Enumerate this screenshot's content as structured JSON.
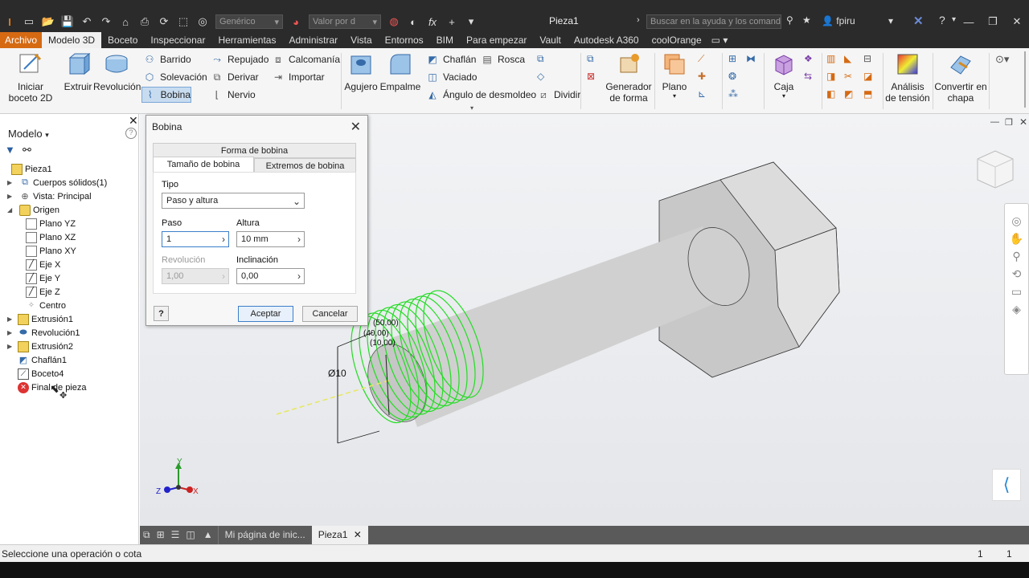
{
  "titlebar": {
    "material_placeholder": "Genérico",
    "appearance_placeholder": "Valor por d",
    "doc_title": "Pieza1",
    "search_placeholder": "Buscar en la ayuda y los comandos",
    "user": "fpiru"
  },
  "menu": {
    "tabs": [
      "Archivo",
      "Modelo 3D",
      "Boceto",
      "Inspeccionar",
      "Herramientas",
      "Administrar",
      "Vista",
      "Entornos",
      "BIM",
      "Para empezar",
      "Vault",
      "Autodesk A360",
      "coolOrange"
    ]
  },
  "ribbon": {
    "iniciar_boceto": "Iniciar\nboceto 2D",
    "extruir": "Extruir",
    "revolucion": "Revolución",
    "barrido": "Barrido",
    "solevacion": "Solevación",
    "bobina": "Bobina",
    "repujado": "Repujado",
    "derivar": "Derivar",
    "nervio": "Nervio",
    "calcomania": "Calcomanía",
    "importar": "Importar",
    "agujero": "Agujero",
    "empalme": "Empalme",
    "chaflan": "Chaflán",
    "rosca": "Rosca",
    "vaciado": "Vaciado",
    "angulo": "Ángulo de desmoldeo",
    "dividir": "Dividir",
    "generador1": "Generador",
    "generador2": "de forma",
    "plano": "Plano",
    "caja": "Caja",
    "analisis1": "Análisis",
    "analisis2": "de tensión",
    "convertir1": "Convertir en",
    "convertir2": "chapa"
  },
  "browser": {
    "header": "Modelo",
    "items": [
      {
        "label": "Pieza1",
        "icon": "part-icon"
      },
      {
        "label": "Cuerpos sólidos(1)",
        "icon": "solid-bodies-icon"
      },
      {
        "label": "Vista: Principal",
        "icon": "view-icon"
      },
      {
        "label": "Origen",
        "icon": "folder-icon"
      },
      {
        "label": "Plano YZ",
        "icon": "plane-icon"
      },
      {
        "label": "Plano XZ",
        "icon": "plane-icon"
      },
      {
        "label": "Plano XY",
        "icon": "plane-icon"
      },
      {
        "label": "Eje X",
        "icon": "axis-icon"
      },
      {
        "label": "Eje Y",
        "icon": "axis-icon"
      },
      {
        "label": "Eje Z",
        "icon": "axis-icon"
      },
      {
        "label": "Centro",
        "icon": "point-icon"
      },
      {
        "label": "Extrusión1",
        "icon": "extrude-icon"
      },
      {
        "label": "Revolución1",
        "icon": "revolve-icon"
      },
      {
        "label": "Extrusión2",
        "icon": "extrude-icon"
      },
      {
        "label": "Chaflán1",
        "icon": "chamfer-icon"
      },
      {
        "label": "Boceto4",
        "icon": "sketch-icon"
      },
      {
        "label": "Final de pieza",
        "icon": "end-of-part-icon"
      }
    ]
  },
  "dialog": {
    "title": "Bobina",
    "tab_forma": "Forma de bobina",
    "tab_tamano": "Tamaño de bobina",
    "tab_extremos": "Extremos de bobina",
    "tipo_label": "Tipo",
    "tipo_value": "Paso y altura",
    "paso_label": "Paso",
    "paso_value": "1",
    "altura_label": "Altura",
    "altura_value": "10 mm",
    "revolucion_label": "Revolución",
    "revolucion_value": "1,00",
    "inclinacion_label": "Inclinación",
    "inclinacion_value": "0,00",
    "help": "?",
    "ok": "Aceptar",
    "cancel": "Cancelar"
  },
  "viewport": {
    "dim_diameter": "Ø10",
    "dim_a": "(50,00)",
    "dim_b": "(40,00)",
    "dim_c": "(10,00)",
    "axis_x": "X",
    "axis_y": "Y",
    "axis_z": "Z",
    "helix_color": "#22dd22"
  },
  "doctabs": {
    "home": "Mi página de inic...",
    "part": "Pieza1"
  },
  "status": {
    "message": "Seleccione una operación o cota",
    "count1": "1",
    "count2": "1"
  }
}
